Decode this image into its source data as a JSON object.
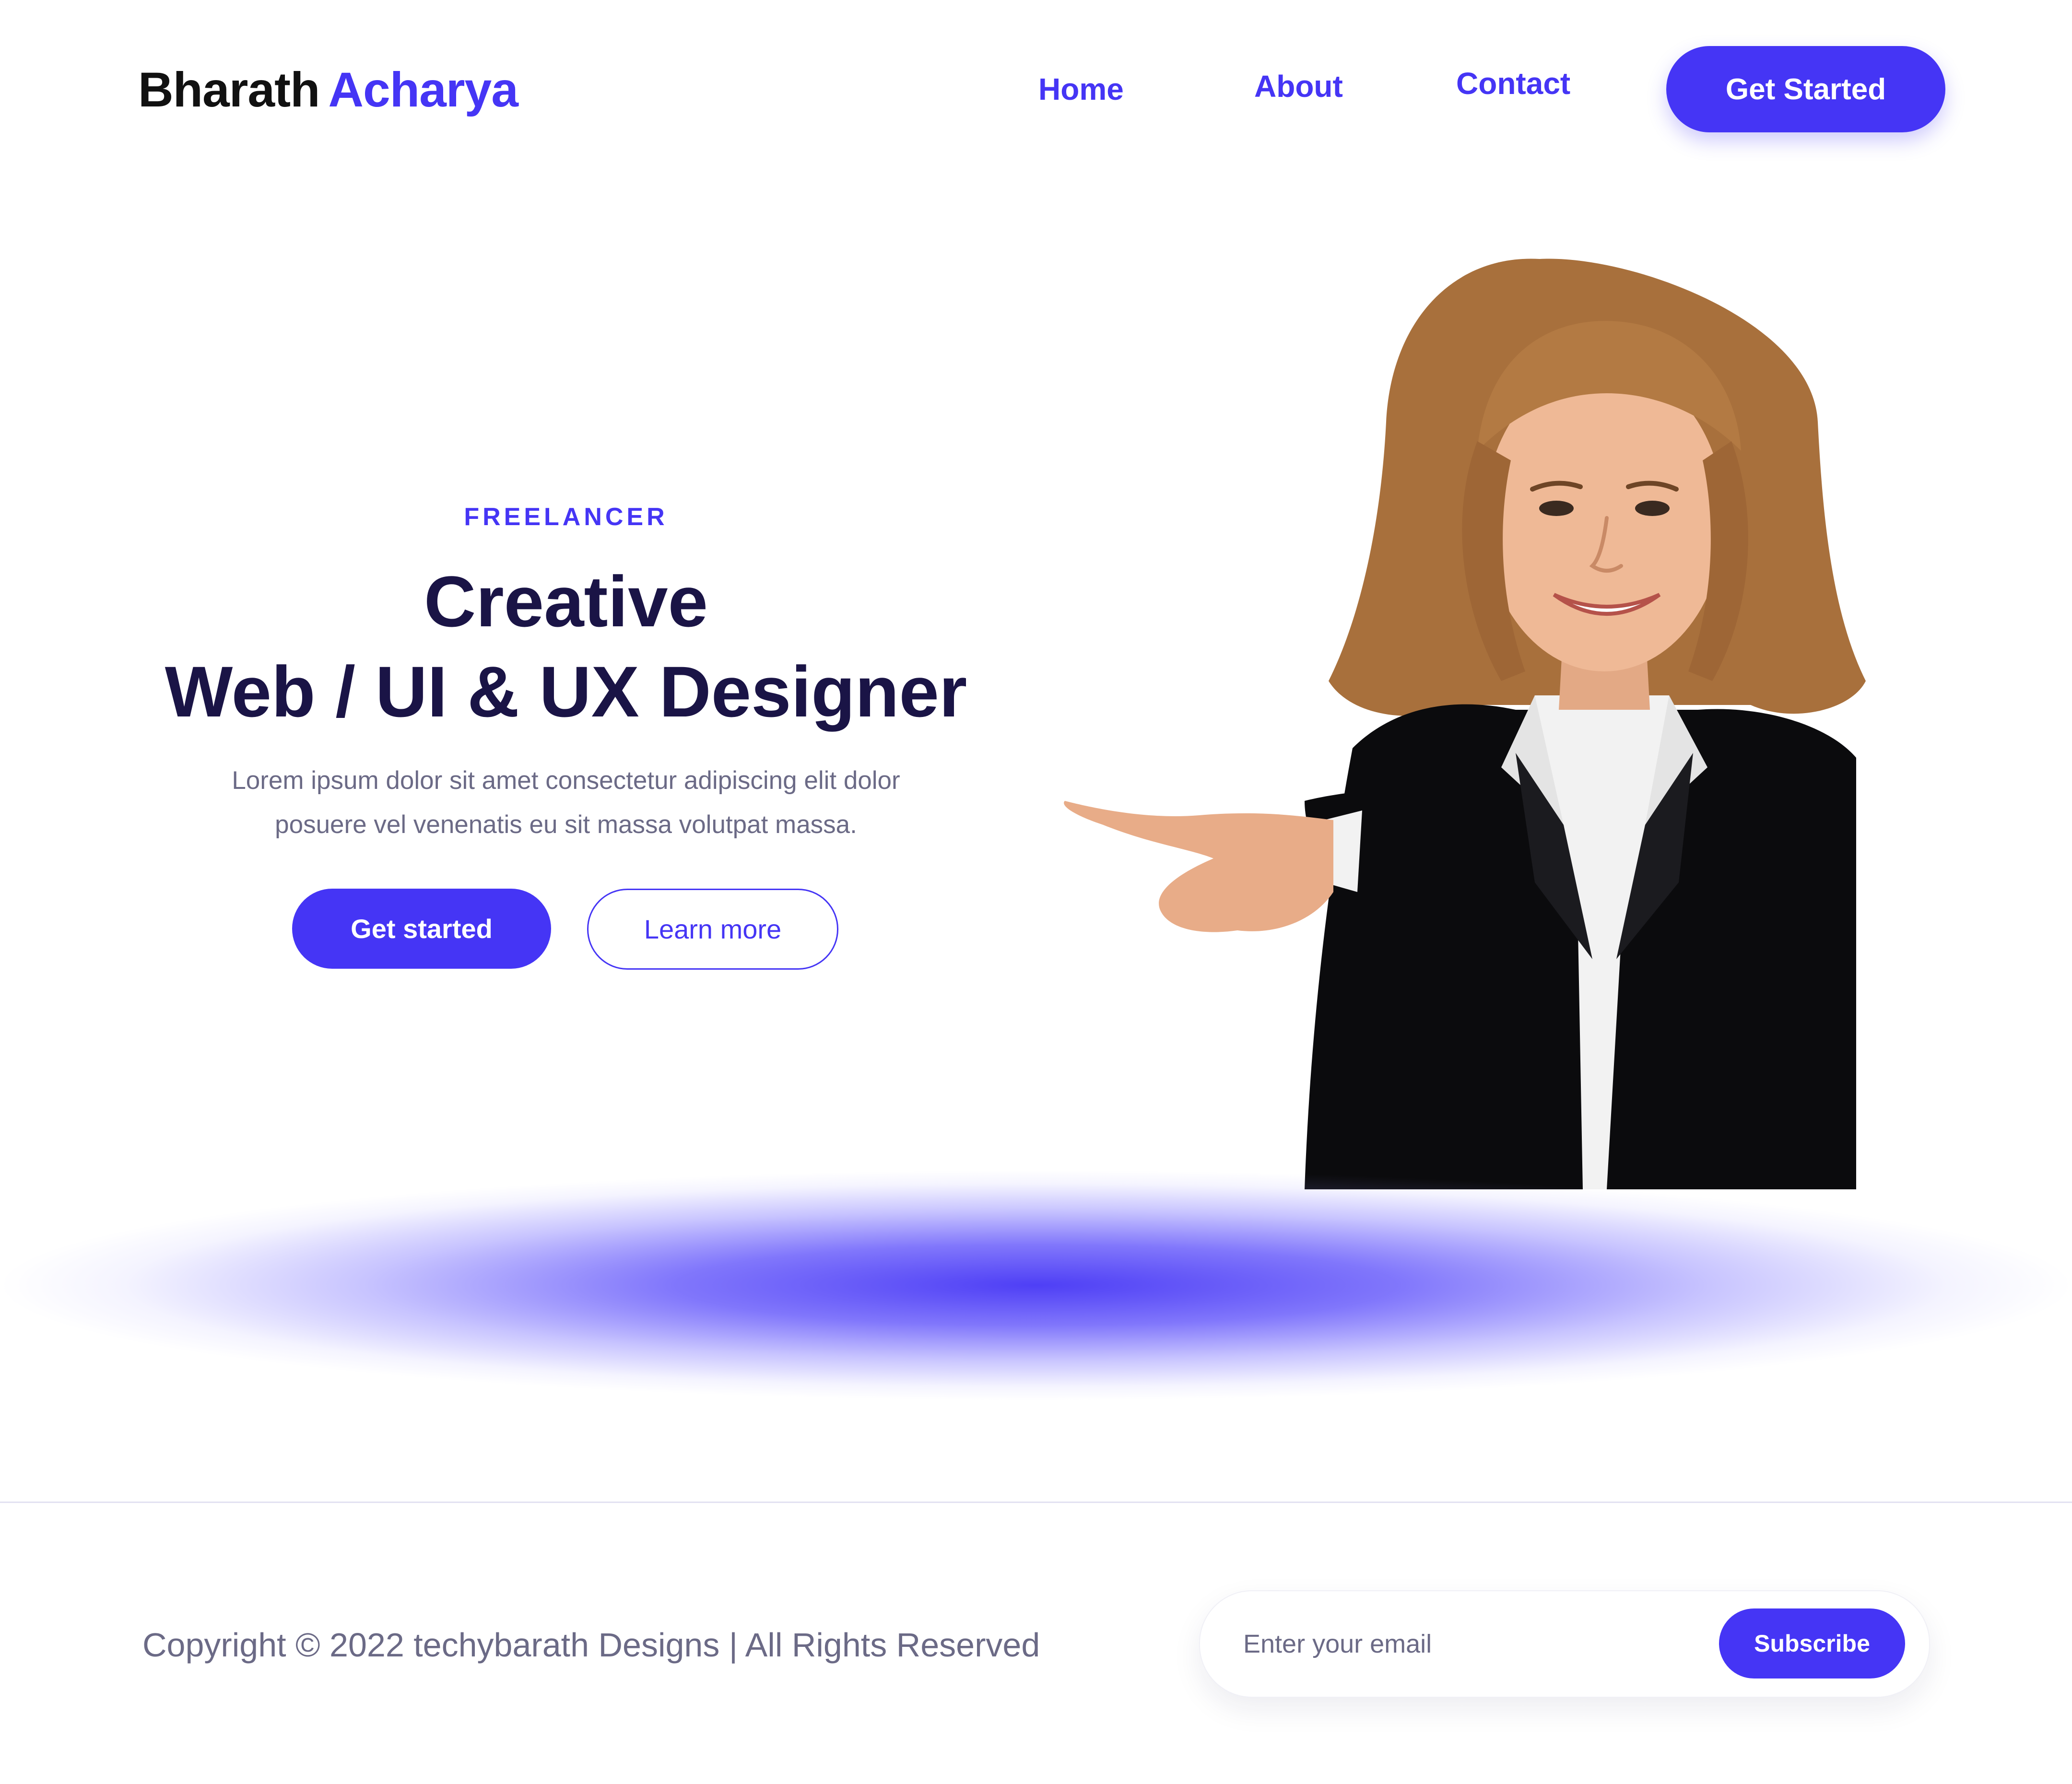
{
  "brand": {
    "first_name": "Bharath",
    "last_name": "Acharya"
  },
  "nav": {
    "items": [
      {
        "label": "Home"
      },
      {
        "label": "About"
      },
      {
        "label": "Contact"
      }
    ],
    "cta_label": "Get Started"
  },
  "hero": {
    "eyebrow": "FREELANCER",
    "title_line1": "Creative",
    "title_line2": "Web / UI & UX Designer",
    "description_line1": "Lorem ipsum dolor sit amet consectetur adipiscing elit dolor",
    "description_line2": "posuere vel venenatis eu sit massa volutpat massa.",
    "primary_button": "Get started",
    "secondary_button": "Learn more"
  },
  "footer": {
    "copyright": "Copyright © 2022 techybarath Designs | All Rights Reserved",
    "email_placeholder": "Enter your email",
    "subscribe_label": "Subscribe"
  },
  "colors": {
    "accent": "#4535f5",
    "heading": "#1a1446",
    "body_text": "#6b6a86",
    "background": "#ffffff"
  }
}
